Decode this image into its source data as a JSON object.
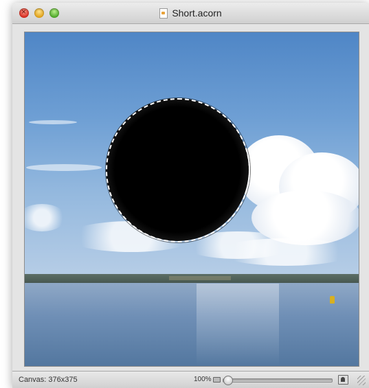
{
  "window": {
    "title": "Short.acorn"
  },
  "canvas": {
    "selection_shape": "ellipse",
    "fill_color": "#000000"
  },
  "statusbar": {
    "canvas_size": "Canvas: 376x375",
    "zoom_level": "100%",
    "zoom_slider_value": 0
  },
  "icons": {
    "close": "close-icon",
    "minimize": "minimize-icon",
    "zoom": "zoom-icon",
    "document": "document-icon",
    "zoom_out": "zoom-out-icon",
    "zoom_in": "zoom-in-icon",
    "resize": "resize-grip-icon"
  }
}
